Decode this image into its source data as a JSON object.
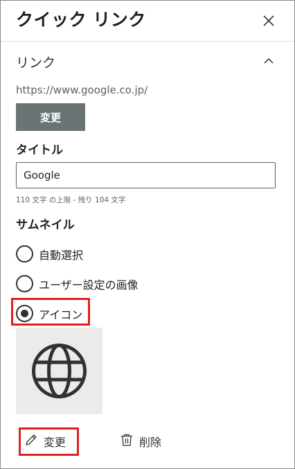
{
  "panel": {
    "title": "クイック リンク",
    "close_icon": "close-icon"
  },
  "link_section": {
    "title": "リンク",
    "chevron_icon": "chevron-up-icon",
    "url": "https://www.google.co.jp/",
    "change_label": "変更"
  },
  "title_field": {
    "label": "タイトル",
    "value": "Google",
    "char_limit": "110 文字 の上限 - 残り 104 文字"
  },
  "thumbnail": {
    "label": "サムネイル",
    "options": [
      {
        "label": "自動選択",
        "selected": false
      },
      {
        "label": "ユーザー設定の画像",
        "selected": false
      },
      {
        "label": "アイコン",
        "selected": true
      }
    ],
    "preview_icon": "globe-icon",
    "edit_label": "変更",
    "edit_icon": "pencil-icon",
    "delete_label": "削除",
    "delete_icon": "trash-icon"
  },
  "colors": {
    "button_bg": "#6b7474",
    "highlight": "#e02020",
    "preview_bg": "#edebe9"
  }
}
